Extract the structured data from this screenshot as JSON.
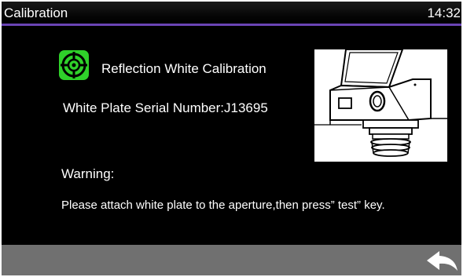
{
  "header": {
    "title": "Calibration",
    "time": "14:32",
    "accent_color": "#6a44b5"
  },
  "calibration": {
    "icon": "target-crosshair-icon",
    "icon_color": "#2fd12a",
    "title": "Reflection White Calibration",
    "serial_label": "White Plate Serial Number:J13695"
  },
  "warning": {
    "label": "Warning:",
    "message": "Please attach white plate to the aperture,then press” test” key."
  },
  "footer": {
    "back_icon": "back-arrow-icon",
    "bar_color": "#707070"
  }
}
